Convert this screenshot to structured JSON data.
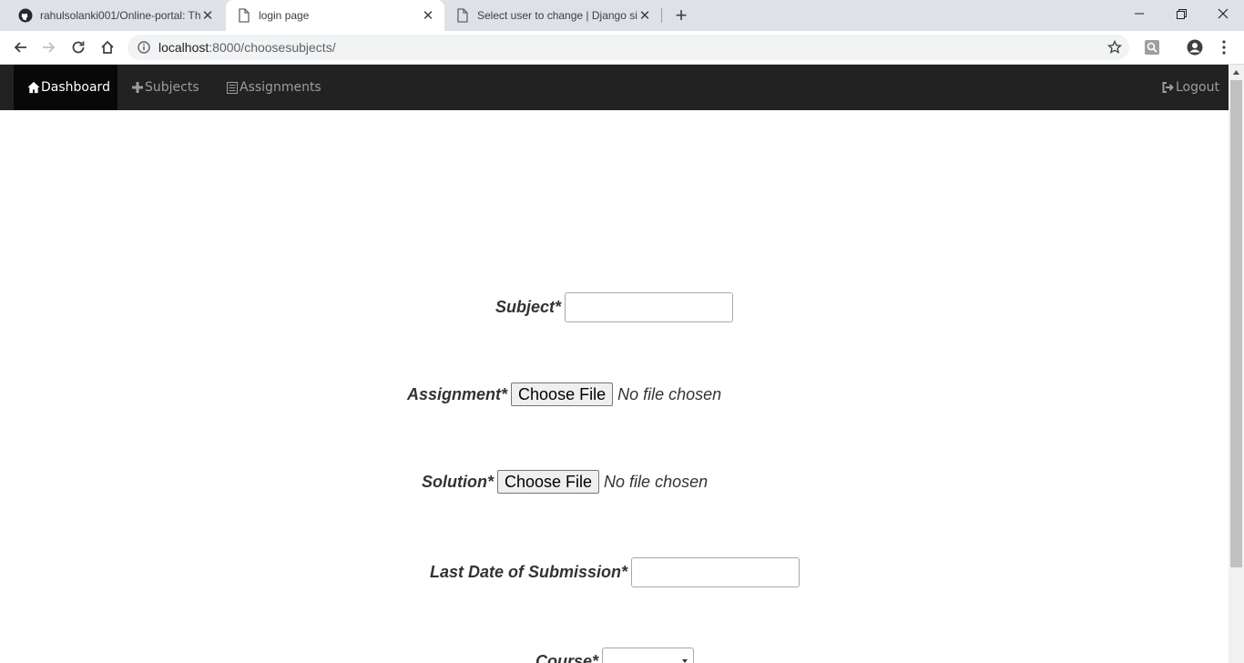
{
  "browser": {
    "tabs": [
      {
        "title": "rahulsolanki001/Online-portal: Th",
        "icon": "github-icon",
        "active": false
      },
      {
        "title": "login page",
        "icon": "page-icon",
        "active": true
      },
      {
        "title": "Select user to change | Django sit",
        "icon": "page-icon",
        "active": false
      }
    ],
    "url_host": "localhost",
    "url_path": ":8000/choosesubjects/"
  },
  "navbar": {
    "dashboard": "Dashboard",
    "subjects": "Subjects",
    "assignments": "Assignments",
    "logout": "Logout"
  },
  "form": {
    "subject_label": "Subject*",
    "subject_value": "",
    "assignment_label": "Assignment*",
    "assignment_button": "Choose File",
    "assignment_status": "No file chosen",
    "solution_label": "Solution*",
    "solution_button": "Choose File",
    "solution_status": "No file chosen",
    "lastdate_label": "Last Date of Submission*",
    "lastdate_value": "",
    "course_label": "Course*",
    "course_selected": ""
  },
  "colors": {
    "navbar_bg": "#222222",
    "navbar_active_bg": "#080808",
    "navbar_text": "#9d9d9d",
    "tabstrip_bg": "#dee1e6"
  }
}
